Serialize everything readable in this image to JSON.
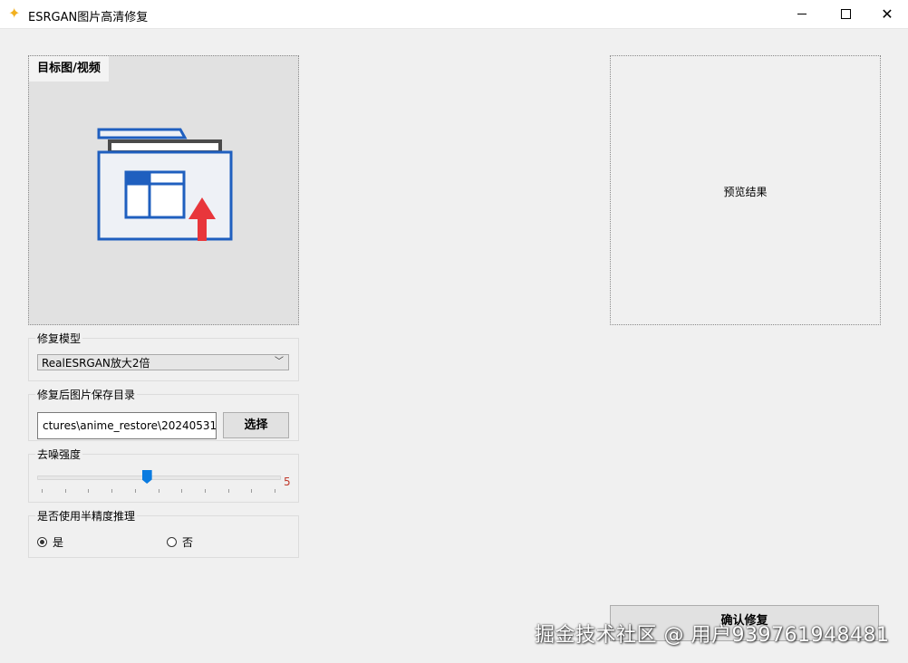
{
  "window": {
    "title": "ESRGAN图片高清修复",
    "icon": "sparkle-icon"
  },
  "target": {
    "label": "目标图/视频",
    "icon": "folder-upload-icon"
  },
  "preview": {
    "text": "预览结果"
  },
  "model_group": {
    "title": "修复模型",
    "selected": "RealESRGAN放大2倍"
  },
  "save_group": {
    "title": "修复后图片保存目录",
    "path": "ctures\\anime_restore\\20240531",
    "choose_label": "选择"
  },
  "denoise_group": {
    "title": "去噪强度",
    "value": "5",
    "min": 0,
    "max": 10,
    "level": 0.45
  },
  "half_group": {
    "title": "是否使用半精度推理",
    "options": [
      "是",
      "否"
    ],
    "selected": "是"
  },
  "confirm_label": "确认修复",
  "watermark": "掘金技术社区 @ 用户939761948481",
  "colors": {
    "accent": "#0a7be0",
    "folder_blue": "#1f5fbf",
    "arrow_red": "#e8363b",
    "value_red": "#c0392b"
  }
}
